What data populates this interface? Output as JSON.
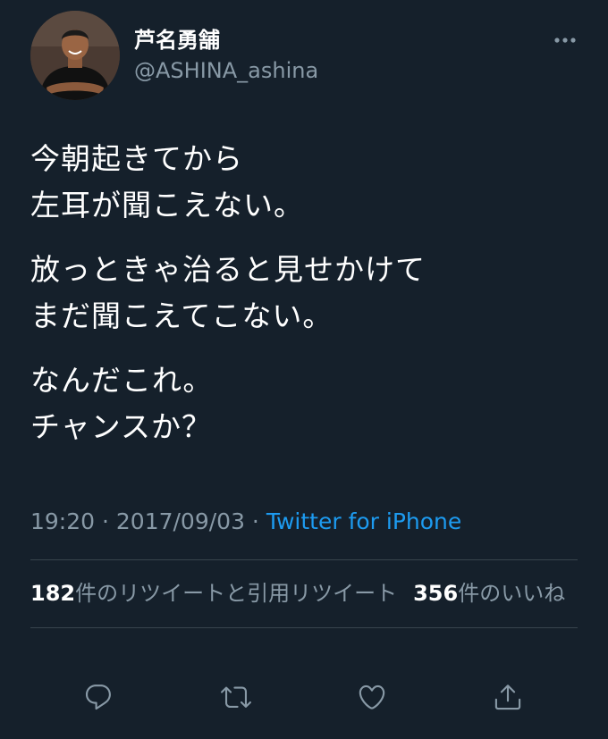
{
  "author": {
    "display_name": "芦名勇舗",
    "handle": "@ASHINA_ashina"
  },
  "tweet": {
    "paragraphs": [
      [
        "今朝起きてから",
        "左耳が聞こえない。"
      ],
      [
        "放っときゃ治ると見せかけて",
        "まだ聞こえてこない。"
      ],
      [
        "なんだこれ。",
        "チャンスか？"
      ]
    ]
  },
  "meta": {
    "time": "19:20",
    "separator": " · ",
    "date": "2017/09/03",
    "source": "Twitter for iPhone"
  },
  "stats": {
    "retweets_count": "182",
    "retweets_label": "件のリツイートと引用リツイート",
    "likes_count": "356",
    "likes_label": "件のいいね"
  },
  "actions": {
    "reply_icon": "reply-icon",
    "retweet_icon": "retweet-icon",
    "like_icon": "heart-icon",
    "share_icon": "share-icon"
  },
  "colors": {
    "background": "#15202b",
    "text": "#ffffff",
    "secondary": "#8899a6",
    "link": "#1d9bf0",
    "divider": "#38444d"
  }
}
